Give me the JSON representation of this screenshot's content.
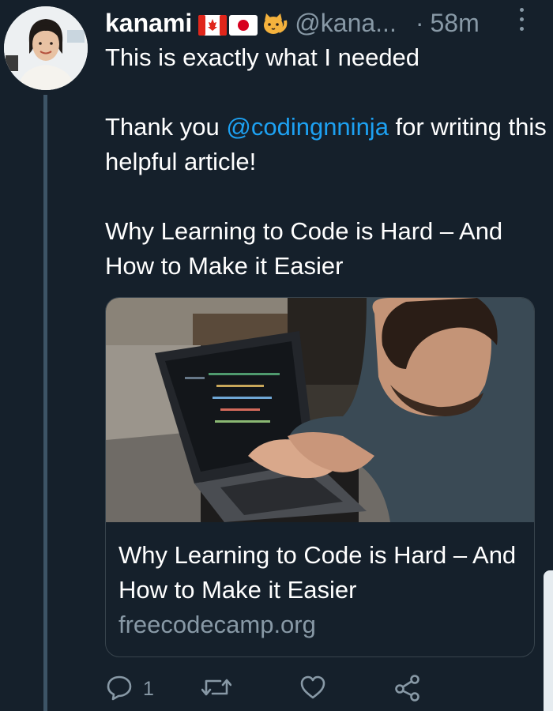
{
  "tweet": {
    "author": {
      "display_name": "kanami",
      "flags": [
        "canada-flag",
        "japan-flag",
        "cat-emoji"
      ],
      "handle": "@kana...",
      "separator": "·",
      "time": "58m"
    },
    "text": {
      "line1": "This is exactly what I needed",
      "thanks_prefix": "Thank you ",
      "mention": "@codingnninja",
      "thanks_suffix": " for writing this helpful article!",
      "article_title": "Why Learning to Code is Hard – And How to Make it Easier"
    },
    "card": {
      "title": "Why Learning to Code is Hard – And How to Make it Easier",
      "domain": "freecodecamp.org"
    },
    "actions": {
      "reply_count": "1"
    }
  },
  "colors": {
    "background": "#15202b",
    "link": "#1da1f2",
    "muted": "#8899a6",
    "thread_line": "#3d5466",
    "card_border": "#38444d"
  },
  "icons": [
    "reply-icon",
    "retweet-icon",
    "like-icon",
    "share-icon",
    "more-icon"
  ]
}
